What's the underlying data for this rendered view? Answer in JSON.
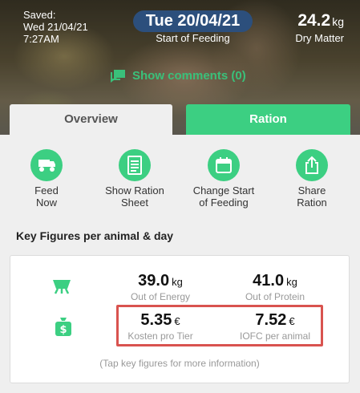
{
  "header": {
    "saved_label": "Saved:",
    "saved_date": "Wed 21/04/21",
    "saved_time": "7:27AM",
    "feeding_date": "Tue 20/04/21",
    "feeding_label": "Start of Feeding",
    "dry_matter_value": "24.2",
    "dry_matter_unit": "kg",
    "dry_matter_label": "Dry Matter",
    "comments_link": "Show comments (0)"
  },
  "tabs": [
    {
      "label": "Overview",
      "active": true
    },
    {
      "label": "Ration",
      "active": false
    }
  ],
  "actions": [
    {
      "icon": "feed-wagon-icon",
      "label_line1": "Feed",
      "label_line2": "Now"
    },
    {
      "icon": "ration-sheet-icon",
      "label_line1": "Show Ration",
      "label_line2": "Sheet"
    },
    {
      "icon": "calendar-icon",
      "label_line1": "Change Start",
      "label_line2": "of Feeding"
    },
    {
      "icon": "share-icon",
      "label_line1": "Share",
      "label_line2": "Ration"
    }
  ],
  "key_figures": {
    "title": "Key Figures per animal & day",
    "energy": {
      "value": "39.0",
      "unit": "kg",
      "label": "Out of Energy"
    },
    "protein": {
      "value": "41.0",
      "unit": "kg",
      "label": "Out of Protein"
    },
    "cost": {
      "value": "5.35",
      "unit": "€",
      "label": "Kosten pro Tier"
    },
    "iofc": {
      "value": "7.52",
      "unit": "€",
      "label": "IOFC per animal"
    },
    "hint": "(Tap key figures for more information)"
  },
  "colors": {
    "accent_green": "#3ccf82",
    "date_pill": "#2c4f7c",
    "highlight_red": "#d9534f"
  }
}
